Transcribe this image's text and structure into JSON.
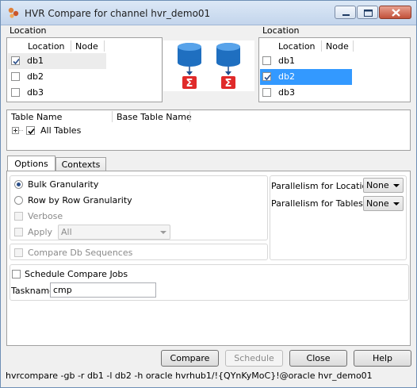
{
  "window": {
    "title": "HVR Compare for channel hvr_demo01",
    "icon": "hvr-app-icon",
    "controls": [
      "minimize-icon",
      "maximize-icon",
      "close-icon"
    ]
  },
  "left_location": {
    "group_label": "Location",
    "headers": {
      "location": "Location",
      "node": "Node"
    },
    "rows": [
      {
        "name": "db1",
        "node": "",
        "checked": true,
        "selected": true
      },
      {
        "name": "db2",
        "node": "",
        "checked": false,
        "selected": false
      },
      {
        "name": "db3",
        "node": "",
        "checked": false,
        "selected": false
      }
    ]
  },
  "right_location": {
    "group_label": "Location",
    "headers": {
      "location": "Location",
      "node": "Node"
    },
    "rows": [
      {
        "name": "db1",
        "node": "",
        "checked": false,
        "selected": false
      },
      {
        "name": "db2",
        "node": "",
        "checked": true,
        "selected": true
      },
      {
        "name": "db3",
        "node": "",
        "checked": false,
        "selected": false
      }
    ]
  },
  "diagram": {
    "icon": "compare-databases-icon"
  },
  "tables": {
    "headers": {
      "table_name": "Table Name",
      "base_table_name": "Base Table Name"
    },
    "root": {
      "label": "All Tables",
      "checked": true,
      "expander": "tree-expand-icon"
    }
  },
  "tabs": [
    {
      "label": "Options",
      "active": true
    },
    {
      "label": "Contexts",
      "active": false
    }
  ],
  "options": {
    "granularity": [
      {
        "label": "Bulk Granularity",
        "selected": true
      },
      {
        "label": "Row by Row Granularity",
        "selected": false
      }
    ],
    "verbose": {
      "label": "Verbose",
      "checked": false,
      "enabled": false
    },
    "apply": {
      "label": "Apply",
      "checked": false,
      "enabled": false,
      "value": "All"
    },
    "compare_db_sequences": {
      "label": "Compare Db Sequences",
      "checked": false,
      "enabled": false
    },
    "parallelism_locations": {
      "label": "Parallelism for Locations",
      "value": "None"
    },
    "parallelism_tables": {
      "label": "Parallelism for Tables",
      "value": "None"
    },
    "schedule": {
      "label": "Schedule Compare Jobs",
      "checked": false
    },
    "taskname": {
      "label": "Taskname",
      "value": "cmp"
    }
  },
  "buttons": {
    "compare": "Compare",
    "schedule": "Schedule",
    "close": "Close",
    "help": "Help"
  },
  "status": "hvrcompare -gb -r db1 -l db2 -h oracle hvrhub1/!{QYnKyMoC}!@oracle hvr_demo01"
}
